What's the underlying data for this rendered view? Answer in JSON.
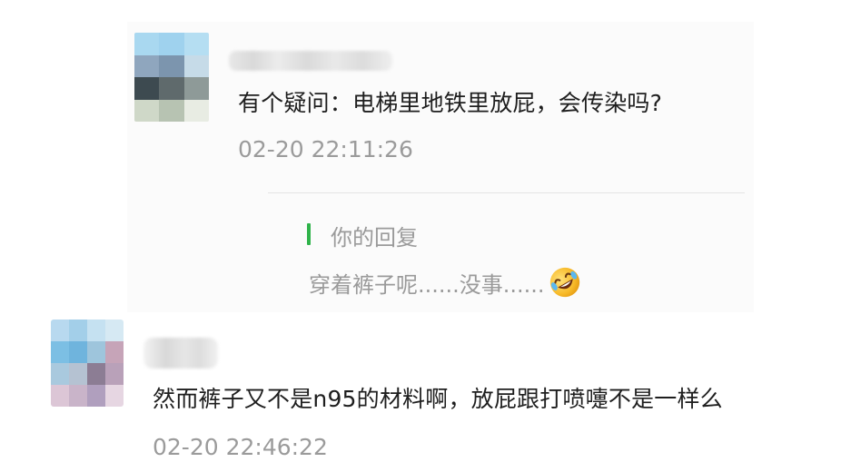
{
  "comments": [
    {
      "text": "有个疑问：电梯里地铁里放屁，会传染吗?",
      "time": "02-20 22:11:26",
      "reply": {
        "label": "你的回复",
        "text": "穿着裤子呢......没事......",
        "emoji": "rolling-on-floor-laughing-icon"
      }
    },
    {
      "text": "然而裤子又不是n95的材料啊，放屁跟打喷嚏不是一样么",
      "time": "02-20 22:46:22"
    }
  ],
  "colors": {
    "reply_accent": "#2fb34a",
    "timestamp": "#9b9b9b",
    "text": "#1e1e1e"
  }
}
